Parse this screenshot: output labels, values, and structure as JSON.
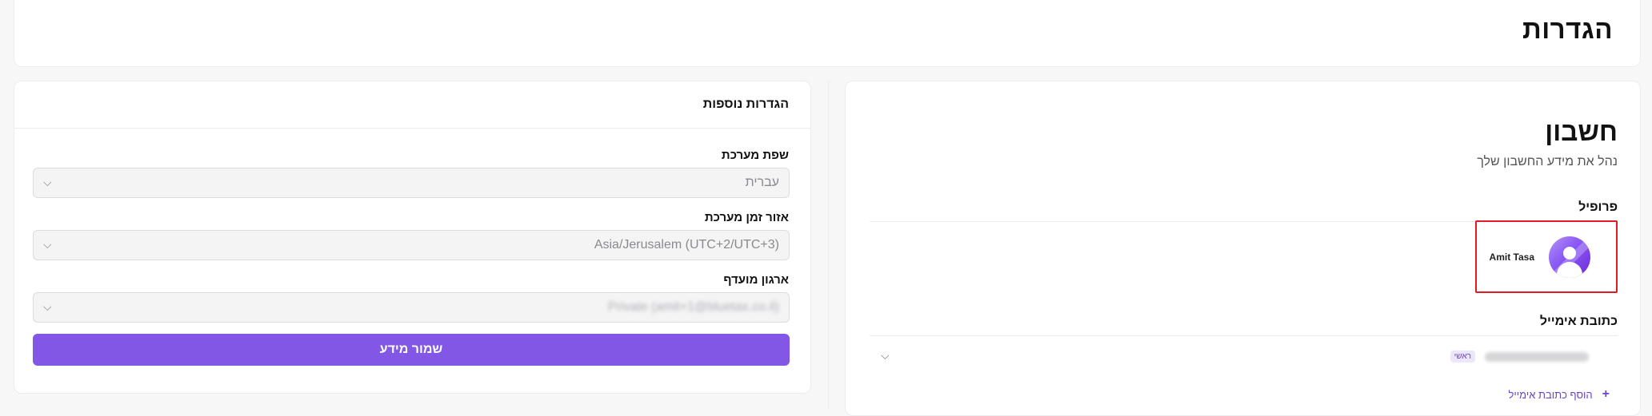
{
  "page": {
    "title": "הגדרות"
  },
  "account": {
    "title": "חשבון",
    "subtitle": "נהל את מידע החשבון שלך",
    "profile_label": "פרופיל",
    "profile_name": "Amit Tasa",
    "email_label": "כתובת אימייל",
    "email_badge": "ראשי",
    "add_email_label": "הוסף כתובת אימייל",
    "avatar_icon": "user-avatar-icon"
  },
  "settings": {
    "title": "הגדרות נוספות",
    "language_label": "שפת מערכת",
    "language_value": "עברית",
    "timezone_label": "אזור זמן מערכת",
    "timezone_value": "Asia/Jerusalem (UTC+2/UTC+3)",
    "org_label": "ארגון מועדף",
    "org_value": "Private (amit+1@bluetax.co.il)",
    "save_label": "שמור מידע"
  },
  "colors": {
    "accent": "#8257e5",
    "highlight": "#e01b24"
  }
}
